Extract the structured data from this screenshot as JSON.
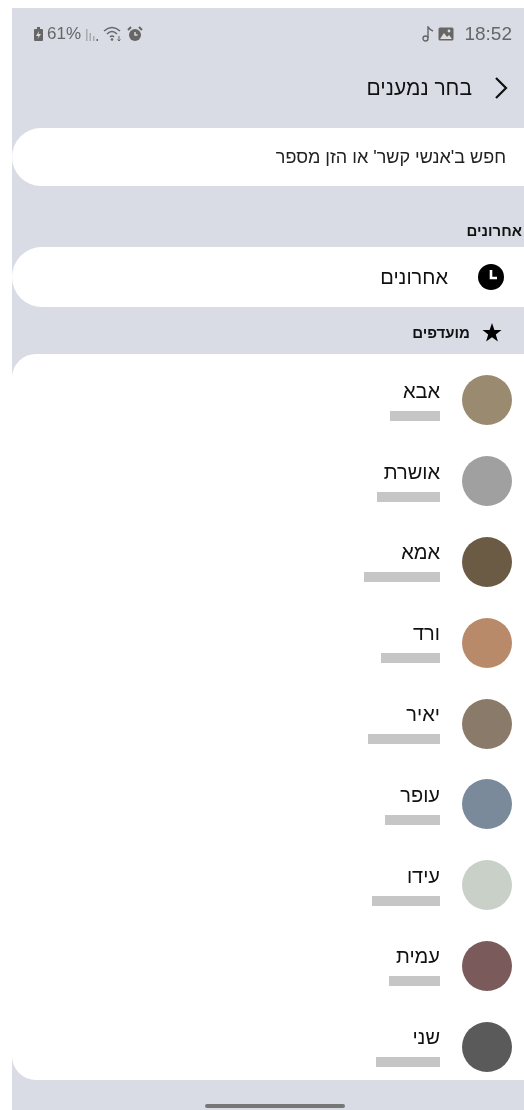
{
  "status_bar": {
    "battery": "61%",
    "time": "18:52"
  },
  "header": {
    "title": "בחר נמענים"
  },
  "search": {
    "placeholder": "חפש ב'אנשי קשר' או הזן מספר"
  },
  "recents": {
    "heading": "אחרונים",
    "item": "אחרונים"
  },
  "favorites": {
    "heading": "מועדפים",
    "contacts": [
      {
        "name": "אבא"
      },
      {
        "name": "אושרת"
      },
      {
        "name": "אמא"
      },
      {
        "name": "ורד"
      },
      {
        "name": "יאיר"
      },
      {
        "name": "עופר"
      },
      {
        "name": "עידו"
      },
      {
        "name": "עמית"
      },
      {
        "name": "שני"
      }
    ]
  }
}
